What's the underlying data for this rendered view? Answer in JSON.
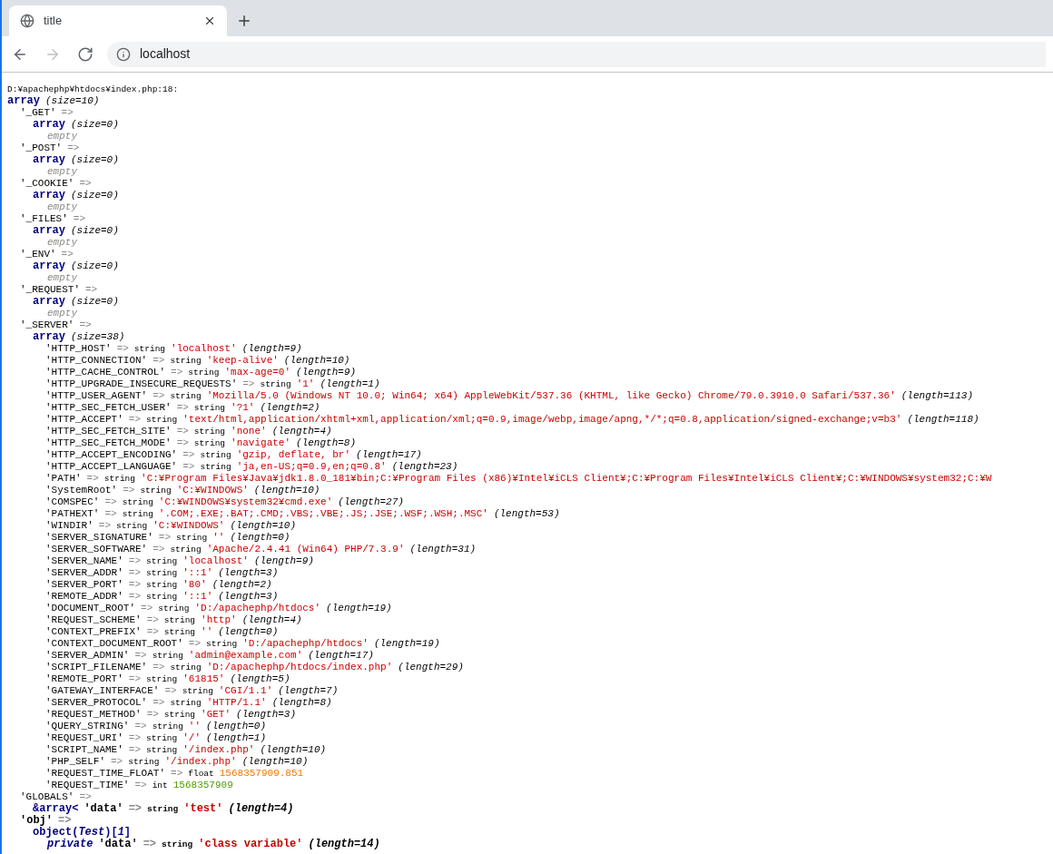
{
  "browser": {
    "tabs": [
      {
        "title": "title",
        "selected": true
      }
    ],
    "nav": [
      {
        "kind": "back",
        "disabled": false
      },
      {
        "kind": "forward",
        "disabled": true
      },
      {
        "kind": "reload",
        "disabled": false
      }
    ],
    "address": "localhost"
  },
  "dump": {
    "location": "D:¥apachephp¥htdocs¥index.php:18:",
    "root": {
      "kind": "array",
      "label": "array",
      "size": "(size=10)",
      "entries": [
        {
          "key": "'_GET'",
          "arrow": "=>",
          "value": {
            "kind": "array",
            "label": "array",
            "size": "(size=0)",
            "empty": "empty"
          }
        },
        {
          "key": "'_POST'",
          "arrow": "=>",
          "value": {
            "kind": "array",
            "label": "array",
            "size": "(size=0)",
            "empty": "empty"
          }
        },
        {
          "key": "'_COOKIE'",
          "arrow": "=>",
          "value": {
            "kind": "array",
            "label": "array",
            "size": "(size=0)",
            "empty": "empty"
          }
        },
        {
          "key": "'_FILES'",
          "arrow": "=>",
          "value": {
            "kind": "array",
            "label": "array",
            "size": "(size=0)",
            "empty": "empty"
          }
        },
        {
          "key": "'_ENV'",
          "arrow": "=>",
          "value": {
            "kind": "array",
            "label": "array",
            "size": "(size=0)",
            "empty": "empty"
          }
        },
        {
          "key": "'_REQUEST'",
          "arrow": "=>",
          "value": {
            "kind": "array",
            "label": "array",
            "size": "(size=0)",
            "empty": "empty"
          }
        },
        {
          "key": "'_SERVER'",
          "arrow": "=>",
          "value": {
            "kind": "array",
            "label": "array",
            "size": "(size=38)",
            "entries": [
              {
                "key": "'HTTP_HOST'",
                "arrow": "=>",
                "type": "string",
                "value": "'localhost'",
                "length": "(length=9)"
              },
              {
                "key": "'HTTP_CONNECTION'",
                "arrow": "=>",
                "type": "string",
                "value": "'keep-alive'",
                "length": "(length=10)"
              },
              {
                "key": "'HTTP_CACHE_CONTROL'",
                "arrow": "=>",
                "type": "string",
                "value": "'max-age=0'",
                "length": "(length=9)"
              },
              {
                "key": "'HTTP_UPGRADE_INSECURE_REQUESTS'",
                "arrow": "=>",
                "type": "string",
                "value": "'1'",
                "length": "(length=1)"
              },
              {
                "key": "'HTTP_USER_AGENT'",
                "arrow": "=>",
                "type": "string",
                "value": "'Mozilla/5.0 (Windows NT 10.0; Win64; x64) AppleWebKit/537.36 (KHTML, like Gecko) Chrome/79.0.3910.0 Safari/537.36'",
                "length": "(length=113)"
              },
              {
                "key": "'HTTP_SEC_FETCH_USER'",
                "arrow": "=>",
                "type": "string",
                "value": "'?1'",
                "length": "(length=2)"
              },
              {
                "key": "'HTTP_ACCEPT'",
                "arrow": "=>",
                "type": "string",
                "value": "'text/html,application/xhtml+xml,application/xml;q=0.9,image/webp,image/apng,*/*;q=0.8,application/signed-exchange;v=b3'",
                "length": "(length=118)"
              },
              {
                "key": "'HTTP_SEC_FETCH_SITE'",
                "arrow": "=>",
                "type": "string",
                "value": "'none'",
                "length": "(length=4)"
              },
              {
                "key": "'HTTP_SEC_FETCH_MODE'",
                "arrow": "=>",
                "type": "string",
                "value": "'navigate'",
                "length": "(length=8)"
              },
              {
                "key": "'HTTP_ACCEPT_ENCODING'",
                "arrow": "=>",
                "type": "string",
                "value": "'gzip, deflate, br'",
                "length": "(length=17)"
              },
              {
                "key": "'HTTP_ACCEPT_LANGUAGE'",
                "arrow": "=>",
                "type": "string",
                "value": "'ja,en-US;q=0.9,en;q=0.8'",
                "length": "(length=23)"
              },
              {
                "key": "'PATH'",
                "arrow": "=>",
                "type": "string",
                "value": "'C:¥Program Files¥Java¥jdk1.8.0_181¥bin;C:¥Program Files (x86)¥Intel¥iCLS Client¥;C:¥Program Files¥Intel¥iCLS Client¥;C:¥WINDOWS¥system32;C:¥W"
              },
              {
                "key": "'SystemRoot'",
                "arrow": "=>",
                "type": "string",
                "value": "'C:¥WINDOWS'",
                "length": "(length=10)"
              },
              {
                "key": "'COMSPEC'",
                "arrow": "=>",
                "type": "string",
                "value": "'C:¥WINDOWS¥system32¥cmd.exe'",
                "length": "(length=27)"
              },
              {
                "key": "'PATHEXT'",
                "arrow": "=>",
                "type": "string",
                "value": "'.COM;.EXE;.BAT;.CMD;.VBS;.VBE;.JS;.JSE;.WSF;.WSH;.MSC'",
                "length": "(length=53)"
              },
              {
                "key": "'WINDIR'",
                "arrow": "=>",
                "type": "string",
                "value": "'C:¥WINDOWS'",
                "length": "(length=10)"
              },
              {
                "key": "'SERVER_SIGNATURE'",
                "arrow": "=>",
                "type": "string",
                "value": "''",
                "length": "(length=0)"
              },
              {
                "key": "'SERVER_SOFTWARE'",
                "arrow": "=>",
                "type": "string",
                "value": "'Apache/2.4.41 (Win64) PHP/7.3.9'",
                "length": "(length=31)"
              },
              {
                "key": "'SERVER_NAME'",
                "arrow": "=>",
                "type": "string",
                "value": "'localhost'",
                "length": "(length=9)"
              },
              {
                "key": "'SERVER_ADDR'",
                "arrow": "=>",
                "type": "string",
                "value": "'::1'",
                "length": "(length=3)"
              },
              {
                "key": "'SERVER_PORT'",
                "arrow": "=>",
                "type": "string",
                "value": "'80'",
                "length": "(length=2)"
              },
              {
                "key": "'REMOTE_ADDR'",
                "arrow": "=>",
                "type": "string",
                "value": "'::1'",
                "length": "(length=3)"
              },
              {
                "key": "'DOCUMENT_ROOT'",
                "arrow": "=>",
                "type": "string",
                "value": "'D:/apachephp/htdocs'",
                "length": "(length=19)"
              },
              {
                "key": "'REQUEST_SCHEME'",
                "arrow": "=>",
                "type": "string",
                "value": "'http'",
                "length": "(length=4)"
              },
              {
                "key": "'CONTEXT_PREFIX'",
                "arrow": "=>",
                "type": "string",
                "value": "''",
                "length": "(length=0)"
              },
              {
                "key": "'CONTEXT_DOCUMENT_ROOT'",
                "arrow": "=>",
                "type": "string",
                "value": "'D:/apachephp/htdocs'",
                "length": "(length=19)"
              },
              {
                "key": "'SERVER_ADMIN'",
                "arrow": "=>",
                "type": "string",
                "value": "'admin@example.com'",
                "length": "(length=17)"
              },
              {
                "key": "'SCRIPT_FILENAME'",
                "arrow": "=>",
                "type": "string",
                "value": "'D:/apachephp/htdocs/index.php'",
                "length": "(length=29)"
              },
              {
                "key": "'REMOTE_PORT'",
                "arrow": "=>",
                "type": "string",
                "value": "'61815'",
                "length": "(length=5)"
              },
              {
                "key": "'GATEWAY_INTERFACE'",
                "arrow": "=>",
                "type": "string",
                "value": "'CGI/1.1'",
                "length": "(length=7)"
              },
              {
                "key": "'SERVER_PROTOCOL'",
                "arrow": "=>",
                "type": "string",
                "value": "'HTTP/1.1'",
                "length": "(length=8)"
              },
              {
                "key": "'REQUEST_METHOD'",
                "arrow": "=>",
                "type": "string",
                "value": "'GET'",
                "length": "(length=3)"
              },
              {
                "key": "'QUERY_STRING'",
                "arrow": "=>",
                "type": "string",
                "value": "''",
                "length": "(length=0)"
              },
              {
                "key": "'REQUEST_URI'",
                "arrow": "=>",
                "type": "string",
                "value": "'/'",
                "length": "(length=1)"
              },
              {
                "key": "'SCRIPT_NAME'",
                "arrow": "=>",
                "type": "string",
                "value": "'/index.php'",
                "length": "(length=10)"
              },
              {
                "key": "'PHP_SELF'",
                "arrow": "=>",
                "type": "string",
                "value": "'/index.php'",
                "length": "(length=10)"
              },
              {
                "key": "'REQUEST_TIME_FLOAT'",
                "arrow": "=>",
                "type": "float",
                "value": "1568357909.851"
              },
              {
                "key": "'REQUEST_TIME'",
                "arrow": "=>",
                "type": "int",
                "value": "1568357909"
              }
            ]
          }
        },
        {
          "key": "'GLOBALS'",
          "arrow": "=>",
          "value": {
            "kind": "reference",
            "label": "&array<",
            "bold": true,
            "entries": [
              {
                "key": "'data'",
                "arrow": "=>",
                "type": "string",
                "value": "'test'",
                "length": "(length=4)"
              }
            ]
          }
        },
        {
          "key": "'obj'",
          "arrow": "=>",
          "bold": true,
          "value": {
            "kind": "object",
            "label": "object(*Test*)[*1*]",
            "bold": true,
            "entries": [
              {
                "visibility": "private",
                "key": "'data'",
                "arrow": "=>",
                "type": "string",
                "value": "'class variable'",
                "length": "(length=14)"
              }
            ]
          }
        }
      ]
    }
  }
}
